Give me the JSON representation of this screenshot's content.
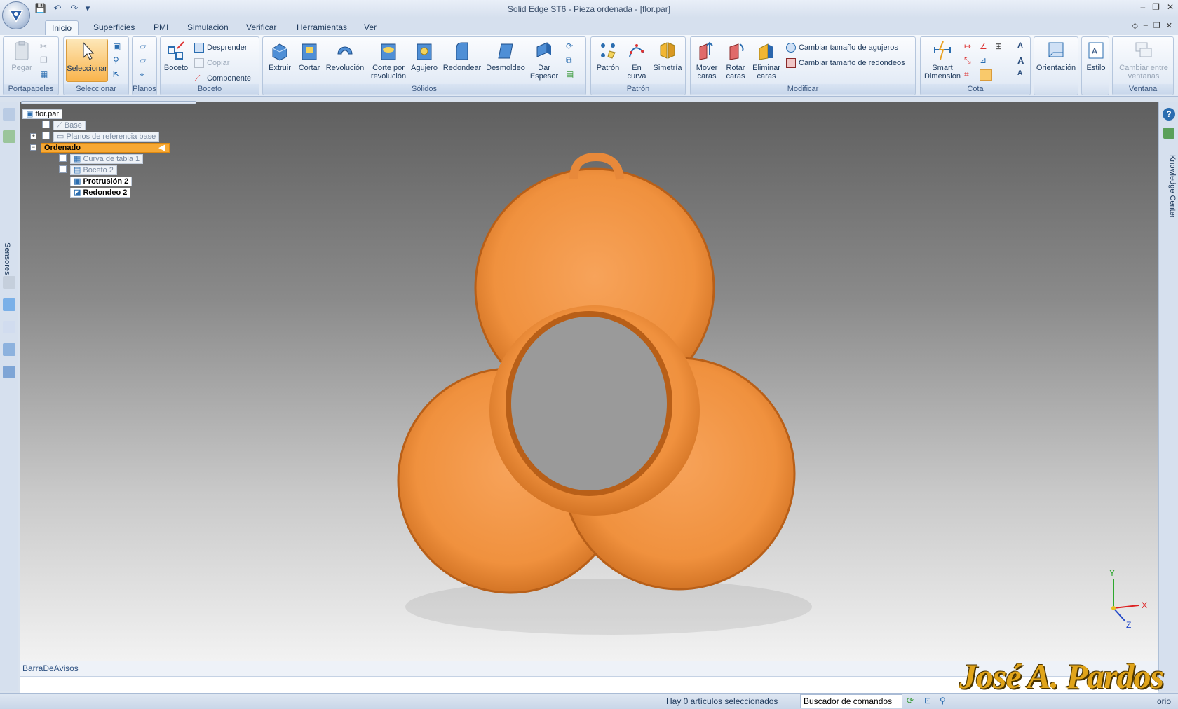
{
  "window": {
    "title": "Solid Edge ST6 - Pieza ordenada - [flor.par]"
  },
  "tabs": [
    "Inicio",
    "Superficies",
    "PMI",
    "Simulación",
    "Verificar",
    "Herramientas",
    "Ver"
  ],
  "ribbon": {
    "portapapeles": {
      "label": "Portapapeles",
      "pegar": "Pegar"
    },
    "seleccionar": {
      "label": "Seleccionar",
      "seleccionar": "Seleccionar"
    },
    "planos": {
      "label": "Planos"
    },
    "boceto": {
      "label": "Boceto",
      "boceto": "Boceto",
      "desprender": "Desprender",
      "copiar": "Copiar",
      "componente": "Componente"
    },
    "solidos": {
      "label": "Sólidos",
      "extruir": "Extruir",
      "cortar": "Cortar",
      "revolucion": "Revolución",
      "corte_por": "Corte por",
      "corte_rev": "revolución",
      "agujero": "Agujero",
      "redondear": "Redondear",
      "desmoldeo": "Desmoldeo",
      "dar": "Dar",
      "espesor": "Espesor"
    },
    "patron": {
      "label": "Patrón",
      "patron": "Patrón",
      "en": "En",
      "curva": "curva",
      "simetria": "Simetría"
    },
    "modificar": {
      "label": "Modificar",
      "mover1": "Mover",
      "mover2": "caras",
      "rotar1": "Rotar",
      "rotar2": "caras",
      "elim1": "Eliminar",
      "elim2": "caras",
      "cambiar_agujeros": "Cambiar tamaño de agujeros",
      "cambiar_redondeos": "Cambiar tamaño de redondeos"
    },
    "cota": {
      "label": "Cota",
      "smart1": "Smart",
      "smart2": "Dimension"
    },
    "orientacion": {
      "label": "Orientación"
    },
    "estilo": {
      "label": "Estilo"
    },
    "ventana": {
      "label": "Ventana",
      "cambiar1": "Cambiar entre",
      "cambiar2": "ventanas"
    }
  },
  "pathfinder": {
    "root": "flor.par",
    "base": "Base",
    "planos": "Planos de referencia base",
    "ordenado": "Ordenado",
    "curva": "Curva de tabla 1",
    "boceto2": "Boceto 2",
    "protrusion": "Protrusión 2",
    "redondeo": "Redondeo 2"
  },
  "side": {
    "sensores": "Sensores",
    "knowledge": "Knowledge Center"
  },
  "axes": {
    "x": "X",
    "y": "Y",
    "z": "Z"
  },
  "messagebar": {
    "title": "BarraDeAvisos"
  },
  "status": {
    "selection": "Hay 0 artículos seleccionados",
    "finder": "Buscador de comandos",
    "tail": "orio"
  },
  "watermark": "José A. Pardos",
  "colors": {
    "part": "#f39a4a",
    "ribbon_accent": "#f7a833"
  }
}
